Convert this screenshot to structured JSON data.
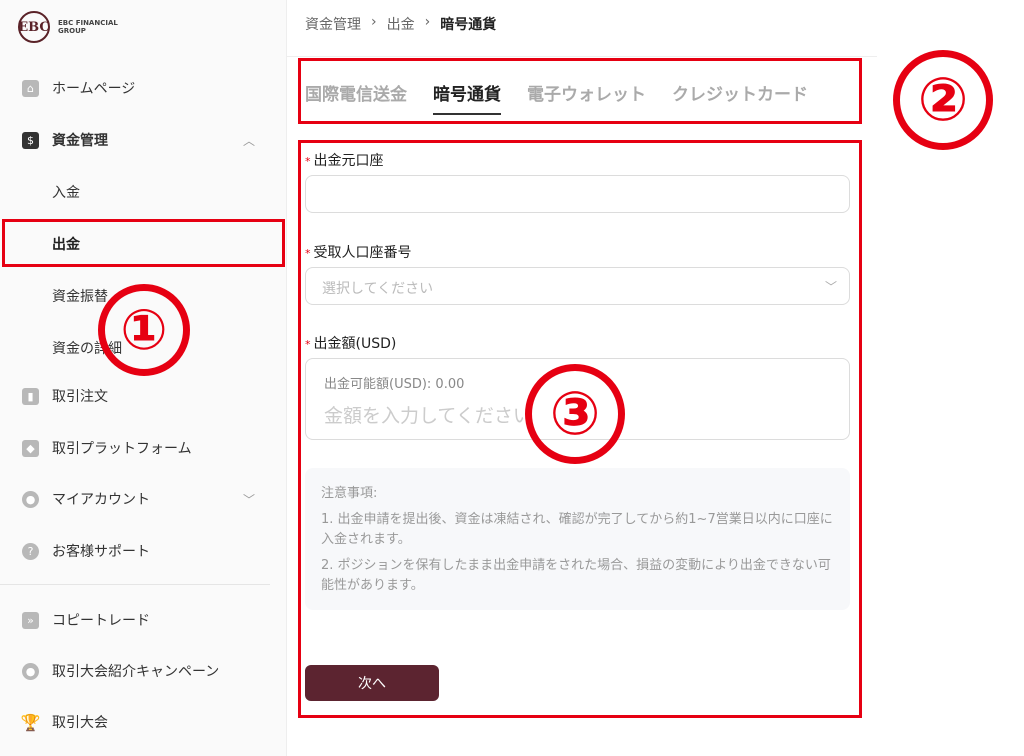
{
  "logo": {
    "mark": "EBC",
    "text": "EBC FINANCIAL GROUP"
  },
  "sidebar": {
    "items": [
      {
        "label": "ホームページ",
        "icon": "home-icon"
      },
      {
        "label": "資金管理",
        "icon": "wallet-icon",
        "expanded": true
      },
      {
        "label": "取引注文",
        "icon": "chart-icon"
      },
      {
        "label": "取引プラットフォーム",
        "icon": "box-icon"
      },
      {
        "label": "マイアカウント",
        "icon": "user-icon"
      },
      {
        "label": "お客様サポート",
        "icon": "help-icon"
      },
      {
        "label": "コピートレード",
        "icon": "copy-icon"
      },
      {
        "label": "取引大会紹介キャンペーン",
        "icon": "people-icon"
      },
      {
        "label": "取引大会",
        "icon": "trophy-icon"
      }
    ],
    "sub_items": [
      "入金",
      "出金",
      "資金振替",
      "資金の詳細"
    ]
  },
  "breadcrumb": [
    "資金管理",
    "出金",
    "暗号通貨"
  ],
  "tabs": [
    "国際電信送金",
    "暗号通貨",
    "電子ウォレット",
    "クレジットカード"
  ],
  "form": {
    "source_label": "出金元口座",
    "recipient_label": "受取人口座番号",
    "recipient_placeholder": "選択してください",
    "amount_label": "出金額(USD)",
    "available": "出金可能額(USD): 0.00",
    "amount_placeholder": "金額を入力してください",
    "notes_title": "注意事項:",
    "note_1": "1. 出金申請を提出後、資金は凍結され、確認が完了してから約1~7営業日以内に口座に入金されます。",
    "note_2": "2. ポジションを保有したまま出金申請をされた場合、損益の変動により出金できない可能性があります。",
    "submit": "次へ"
  },
  "annotations": [
    "①",
    "②",
    "③"
  ],
  "colors": {
    "accent": "#5c2430",
    "annotation": "#e60012"
  }
}
